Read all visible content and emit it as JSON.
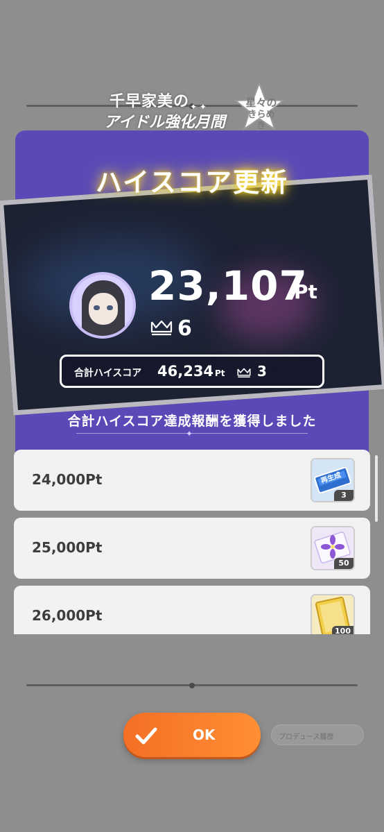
{
  "event": {
    "title_line1": "千早家美の",
    "title_line2": "アイドル強化月間",
    "subtitle_line1": "星々の",
    "subtitle_line2": "きらめき"
  },
  "result": {
    "headline": "ハイスコア更新",
    "score": "23,107",
    "score_unit": "Pt",
    "rank": "6",
    "total_label": "合計ハイスコア",
    "total_score": "46,234",
    "total_unit": "Pt",
    "total_rank": "3"
  },
  "reward_caption": "合計ハイスコア達成報酬を獲得しました",
  "rewards": [
    {
      "threshold": "24,000Pt",
      "item_icon": "regeneration-ticket-icon",
      "item_label": "再生成",
      "quantity": "3"
    },
    {
      "threshold": "25,000Pt",
      "item_icon": "purple-flower-card-icon",
      "quantity": "50"
    },
    {
      "threshold": "26,000Pt",
      "item_icon": "gold-card-icon",
      "quantity": "100"
    }
  ],
  "buttons": {
    "ok_label": "OK",
    "produce_label": "プロデュース履歴"
  },
  "colors": {
    "panel": "#5a4ab8",
    "accent": "#f46f25",
    "glow": "#ffe24a"
  }
}
